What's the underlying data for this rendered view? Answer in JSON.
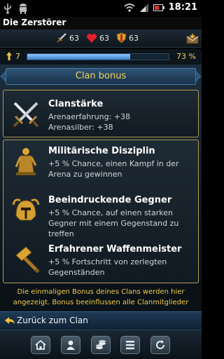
{
  "status_bar": {
    "time": "18:21"
  },
  "app": {
    "title": "Die Zerstörer"
  },
  "stats": {
    "attack": "63",
    "health": "63",
    "defense": "63"
  },
  "xp": {
    "level": "7",
    "progress_label": "73 %",
    "progress": 0.73
  },
  "banner": {
    "title": "Clan bonus"
  },
  "clan_strength": {
    "name": "Clanstärke",
    "line1": "Arenaerfahrung: +38",
    "line2": "Arenasilber: +38"
  },
  "bonuses": [
    {
      "name": "Militärische Disziplin",
      "desc": "+5 % Chance, einen Kampf in der Arena zu gewinnen",
      "icon": "golden-statue-icon"
    },
    {
      "name": "Beeindruckende Gegner",
      "desc": "+5 % Chance, auf einen starken Gegner mit einem Gegenstand zu treffen",
      "icon": "golden-helmet-icon"
    },
    {
      "name": "Erfahrener Waffenmeister",
      "desc": "+5 % Fortschritt von zerlegten Gegenständen",
      "icon": "golden-hammer-icon"
    }
  ],
  "info": {
    "line1": "Die einmaligen Bonus deines Clans werden hier",
    "line2": "angezeigt. Bonus beeinflussen alle Clanmitglieder"
  },
  "back": {
    "label": "Zurück zum Clan"
  },
  "nav_icons": [
    "home-icon",
    "profile-icon",
    "coins-icon",
    "list-icon",
    "refresh-icon"
  ],
  "colors": {
    "accent_gold": "#f2d35c",
    "panel_border": "#b49a52",
    "xp_fill": "#5fa4e6"
  }
}
